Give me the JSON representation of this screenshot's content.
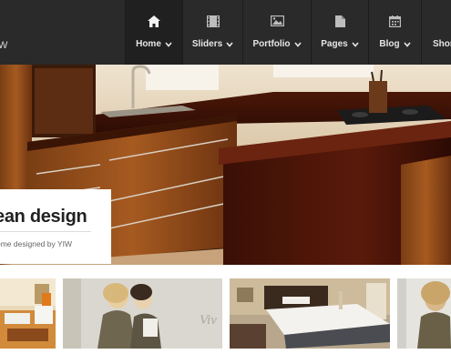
{
  "header": {
    "logo_fragment": "W",
    "nav": [
      {
        "label": "Home",
        "icon": "home-icon",
        "active": true
      },
      {
        "label": "Sliders",
        "icon": "film-icon",
        "active": false
      },
      {
        "label": "Portfolio",
        "icon": "image-icon",
        "active": false
      },
      {
        "label": "Pages",
        "icon": "page-icon",
        "active": false
      },
      {
        "label": "Blog",
        "icon": "calendar-icon",
        "active": false
      },
      {
        "label": "Shor",
        "icon": "",
        "active": false
      }
    ]
  },
  "slider": {
    "caption_title": "ean design",
    "caption_subtitle": "eme designed by YIW"
  },
  "thumbnails": [
    {
      "name": "living-room-thumbnail"
    },
    {
      "name": "fashion-thumbnail",
      "overlay_text": "Viv"
    },
    {
      "name": "bedroom-thumbnail"
    },
    {
      "name": "portrait-thumbnail"
    }
  ],
  "colors": {
    "header_bg": "#2a2a2a",
    "active_nav_bg": "#202020",
    "nav_text": "#e6e6e6"
  }
}
